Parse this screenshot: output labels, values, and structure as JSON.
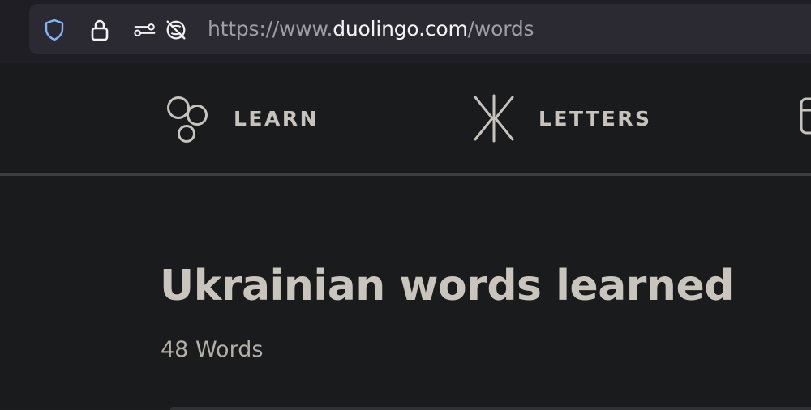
{
  "browser": {
    "url_scheme": "https://www.",
    "url_host": "duolingo.com",
    "url_path": "/words",
    "icons": [
      "shield-icon",
      "lock-icon",
      "permissions-icon",
      "tracking-blocked-icon"
    ]
  },
  "nav": {
    "items": [
      {
        "label": "LEARN",
        "icon": "learn-bubbles-icon"
      },
      {
        "label": "LETTERS",
        "icon": "letters-zhe-icon"
      },
      {
        "label": "",
        "icon": "partial-nav-icon"
      }
    ]
  },
  "main": {
    "title": "Ukrainian words learned",
    "count": "48 Words"
  },
  "colors": {
    "background": "#191b1d",
    "nav_text": "#c7c3bc",
    "title_text": "#c9c4bc",
    "url_host": "#f3f3f4",
    "shield_accent": "#7fb6ff"
  }
}
